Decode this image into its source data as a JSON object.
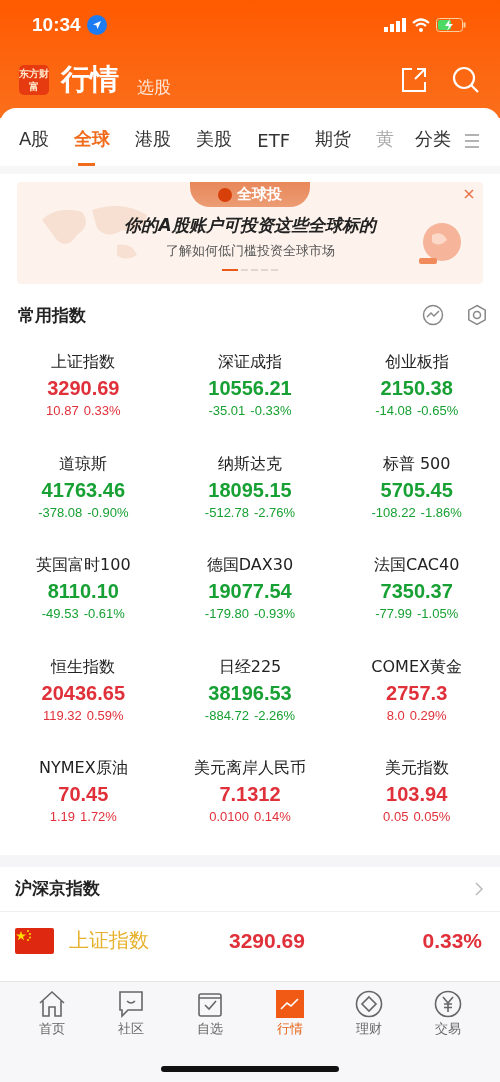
{
  "status_bar": {
    "time": "10:34"
  },
  "header": {
    "logo_text": "东方财富",
    "title": "行情",
    "subtitle": "选股"
  },
  "tabs": [
    {
      "label": "A股",
      "selected": false,
      "faded": false
    },
    {
      "label": "全球",
      "selected": true,
      "faded": false
    },
    {
      "label": "港股",
      "selected": false,
      "faded": false
    },
    {
      "label": "美股",
      "selected": false,
      "faded": false
    },
    {
      "label": "ETF",
      "selected": false,
      "faded": false
    },
    {
      "label": "期货",
      "selected": false,
      "faded": false
    },
    {
      "label": "黄",
      "selected": false,
      "faded": true
    }
  ],
  "category_button": "分类",
  "banner": {
    "badge": "全球投",
    "headline": "你的A股账户可投资这些全球标的",
    "subtext": "了解如何低门槛投资全球市场",
    "pager": [
      {
        "selected": true
      },
      {
        "selected": false
      },
      {
        "selected": false
      },
      {
        "selected": false
      },
      {
        "selected": false
      }
    ]
  },
  "common_indices": {
    "title": "常用指数",
    "items": [
      {
        "name": "上证指数",
        "value": "3290.69",
        "change": "10.87",
        "percent": "0.33%",
        "color": "#e0303a"
      },
      {
        "name": "深证成指",
        "value": "10556.21",
        "change": "-35.01",
        "percent": "-0.33%",
        "color": "#17a033"
      },
      {
        "name": "创业板指",
        "value": "2150.38",
        "change": "-14.08",
        "percent": "-0.65%",
        "color": "#17a033"
      },
      {
        "name": "道琼斯",
        "value": "41763.46",
        "change": "-378.08",
        "percent": "-0.90%",
        "color": "#17a033"
      },
      {
        "name": "纳斯达克",
        "value": "18095.15",
        "change": "-512.78",
        "percent": "-2.76%",
        "color": "#17a033"
      },
      {
        "name": "标普 500",
        "value": "5705.45",
        "change": "-108.22",
        "percent": "-1.86%",
        "color": "#17a033"
      },
      {
        "name": "英国富时100",
        "value": "8110.10",
        "change": "-49.53",
        "percent": "-0.61%",
        "color": "#17a033"
      },
      {
        "name": "德国DAX30",
        "value": "19077.54",
        "change": "-179.80",
        "percent": "-0.93%",
        "color": "#17a033"
      },
      {
        "name": "法国CAC40",
        "value": "7350.37",
        "change": "-77.99",
        "percent": "-1.05%",
        "color": "#17a033"
      },
      {
        "name": "恒生指数",
        "value": "20436.65",
        "change": "119.32",
        "percent": "0.59%",
        "color": "#e0303a"
      },
      {
        "name": "日经225",
        "value": "38196.53",
        "change": "-884.72",
        "percent": "-2.26%",
        "color": "#17a033"
      },
      {
        "name": "COMEX黄金",
        "value": "2757.3",
        "change": "8.0",
        "percent": "0.29%",
        "color": "#e0303a"
      },
      {
        "name": "NYMEX原油",
        "value": "70.45",
        "change": "1.19",
        "percent": "1.72%",
        "color": "#e0303a"
      },
      {
        "name": "美元离岸人民币",
        "value": "7.1312",
        "change": "0.0100",
        "percent": "0.14%",
        "color": "#e0303a"
      },
      {
        "name": "美元指数",
        "value": "103.94",
        "change": "0.05",
        "percent": "0.05%",
        "color": "#e0303a"
      }
    ]
  },
  "hs_indices": {
    "title": "沪深京指数",
    "rows": [
      {
        "name": "上证指数",
        "value": "3290.69",
        "percent": "0.33%",
        "color": "#e0303a"
      }
    ]
  },
  "bottom_nav": [
    {
      "label": "首页",
      "kind": "home",
      "selected": false
    },
    {
      "label": "社区",
      "kind": "chat",
      "selected": false
    },
    {
      "label": "自选",
      "kind": "check",
      "selected": false
    },
    {
      "label": "行情",
      "kind": "chart",
      "selected": true
    },
    {
      "label": "理财",
      "kind": "diamond",
      "selected": false
    },
    {
      "label": "交易",
      "kind": "yen",
      "selected": false
    }
  ]
}
